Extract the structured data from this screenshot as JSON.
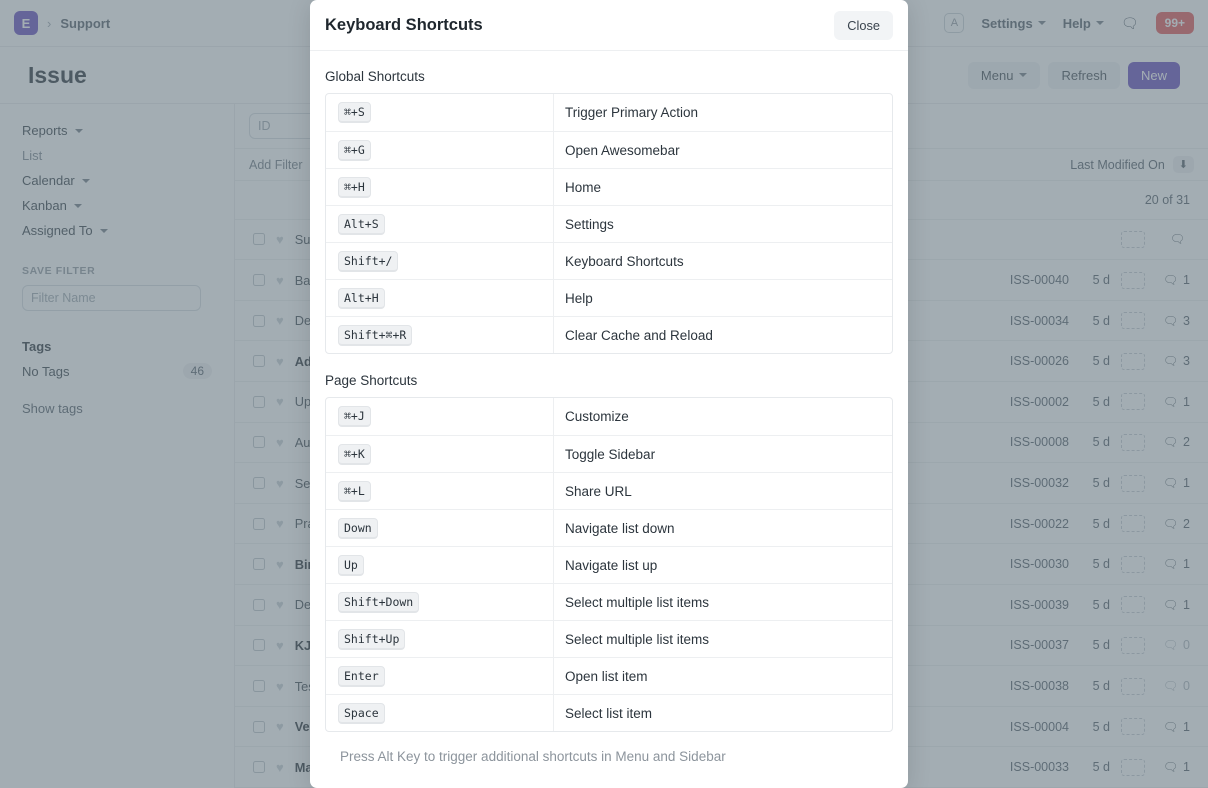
{
  "navbar": {
    "logo_letter": "E",
    "breadcrumb": "Support",
    "avatar_letter": "A",
    "settings_label": "Settings",
    "help_label": "Help",
    "notifications_badge": "99+"
  },
  "page": {
    "title": "Issue",
    "menu_label": "Menu",
    "refresh_label": "Refresh",
    "new_label": "New"
  },
  "sidebar": {
    "items": [
      {
        "label": "Reports",
        "caret": true,
        "muted": false
      },
      {
        "label": "List",
        "caret": false,
        "muted": true
      },
      {
        "label": "Calendar",
        "caret": true,
        "muted": false
      },
      {
        "label": "Kanban",
        "caret": true,
        "muted": false
      },
      {
        "label": "Assigned To",
        "caret": true,
        "muted": false
      }
    ],
    "save_filter_label": "SAVE FILTER",
    "filter_name_placeholder": "Filter Name",
    "tags_title": "Tags",
    "no_tags_label": "No Tags",
    "no_tags_count": "46",
    "show_tags_label": "Show tags"
  },
  "listview": {
    "id_placeholder": "ID",
    "add_filter_label": "Add Filter",
    "sort_label": "Last Modified On",
    "sort_direction_icon": "arrow-down-icon",
    "count_label": "20 of 31",
    "rows": [
      {
        "title": "Sub",
        "id": "",
        "age": "",
        "comments": "",
        "bold": false
      },
      {
        "title": "Bas",
        "id": "ISS-00040",
        "age": "5 d",
        "comments": "1",
        "bold": false
      },
      {
        "title": "Del",
        "id": "ISS-00034",
        "age": "5 d",
        "comments": "3",
        "bold": false
      },
      {
        "title": "Adm",
        "id": "ISS-00026",
        "age": "5 d",
        "comments": "3",
        "bold": true
      },
      {
        "title": "Upd",
        "id": "ISS-00002",
        "age": "5 d",
        "comments": "1",
        "bold": false
      },
      {
        "title": "Aut",
        "id": "ISS-00008",
        "age": "5 d",
        "comments": "2",
        "bold": false
      },
      {
        "title": "Sec",
        "id": "ISS-00032",
        "age": "5 d",
        "comments": "1",
        "bold": false
      },
      {
        "title": "Pra",
        "id": "ISS-00022",
        "age": "5 d",
        "comments": "2",
        "bold": false
      },
      {
        "title": "Birt",
        "id": "ISS-00030",
        "age": "5 d",
        "comments": "1",
        "bold": true
      },
      {
        "title": "Del",
        "id": "ISS-00039",
        "age": "5 d",
        "comments": "1",
        "bold": false
      },
      {
        "title": "KJH",
        "id": "ISS-00037",
        "age": "5 d",
        "comments": "0",
        "bold": true
      },
      {
        "title": "Tes",
        "id": "ISS-00038",
        "age": "5 d",
        "comments": "0",
        "bold": false
      },
      {
        "title": "Ver",
        "id": "ISS-00004",
        "age": "5 d",
        "comments": "1",
        "bold": true
      },
      {
        "title": "Mai",
        "id": "ISS-00033",
        "age": "5 d",
        "comments": "1",
        "bold": true
      }
    ]
  },
  "modal": {
    "title": "Keyboard Shortcuts",
    "close_label": "Close",
    "global_section_title": "Global Shortcuts",
    "page_section_title": "Page Shortcuts",
    "footer_note": "Press Alt Key to trigger additional shortcuts in Menu and Sidebar",
    "global_shortcuts": [
      {
        "keys": "⌘+S",
        "description": "Trigger Primary Action"
      },
      {
        "keys": "⌘+G",
        "description": "Open Awesomebar"
      },
      {
        "keys": "⌘+H",
        "description": "Home"
      },
      {
        "keys": "Alt+S",
        "description": "Settings"
      },
      {
        "keys": "Shift+/",
        "description": "Keyboard Shortcuts"
      },
      {
        "keys": "Alt+H",
        "description": "Help"
      },
      {
        "keys": "Shift+⌘+R",
        "description": "Clear Cache and Reload"
      }
    ],
    "page_shortcuts": [
      {
        "keys": "⌘+J",
        "description": "Customize"
      },
      {
        "keys": "⌘+K",
        "description": "Toggle Sidebar"
      },
      {
        "keys": "⌘+L",
        "description": "Share URL"
      },
      {
        "keys": "Down",
        "description": "Navigate list down"
      },
      {
        "keys": "Up",
        "description": "Navigate list up"
      },
      {
        "keys": "Shift+Down",
        "description": "Select multiple list items"
      },
      {
        "keys": "Shift+Up",
        "description": "Select multiple list items"
      },
      {
        "keys": "Enter",
        "description": "Open list item"
      },
      {
        "keys": "Space",
        "description": "Select list item"
      }
    ]
  },
  "colors": {
    "brand": "#5e43ba",
    "danger": "#e24c4c",
    "overlay": "rgba(107,122,133,0.62)"
  }
}
